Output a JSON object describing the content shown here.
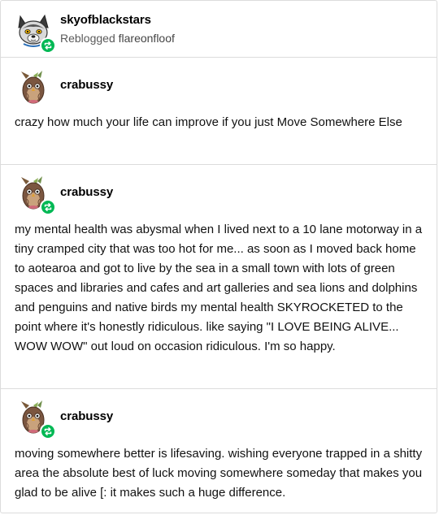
{
  "header": {
    "username": "skyofblackstars",
    "reblogged_prefix": "Reblogged",
    "reblogged_from": "flareonfloof"
  },
  "trail": [
    {
      "username": "crabussy",
      "text": "crazy how much your life can improve if you just Move Somewhere Else",
      "reblog_badge": false
    },
    {
      "username": "crabussy",
      "text": "my mental health was abysmal when I lived next to a 10 lane motorway in a tiny cramped city that was too hot for me... as soon as I moved back home to aotearoa and got to live by the sea in a small town with lots of green spaces and libraries and cafes and art galleries and sea lions and dolphins and penguins and native birds my mental health SKYROCKETED to the point where it's honestly ridiculous. like saying \"I LOVE BEING ALIVE... WOW WOW\" out loud on occasion ridiculous. I'm so happy.",
      "reblog_badge": true
    },
    {
      "username": "crabussy",
      "text": "moving somewhere better is lifesaving. wishing everyone trapped in a shitty area the absolute best of luck moving somewhere someday that makes you glad to be alive [: it makes such a huge difference.",
      "reblog_badge": true
    }
  ],
  "icons": {
    "reblog": "reblog-icon",
    "avatar_header": "wolf-avatar",
    "avatar_trail": "owl-avatar"
  },
  "colors": {
    "reblog_green": "#00b854",
    "divider": "#dcdcdc",
    "secondary_text": "#5a5a5a"
  }
}
